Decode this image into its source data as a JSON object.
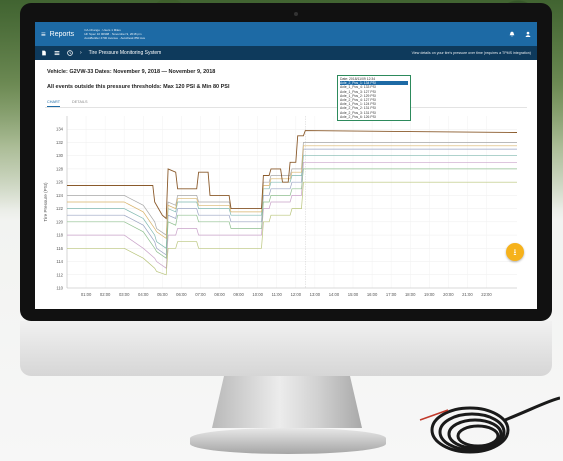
{
  "appbar": {
    "menu_icon": "≡",
    "title": "Reports",
    "info_lines": [
      "CA-Change · Users 1 Miles",
      "HF Spec 10 00998 · November 9, 2018 pm",
      "AutoBuilder 4700 Avenue · AutoDesk 850 Ave"
    ],
    "right_icons": [
      "bell-icon",
      "user-icon"
    ]
  },
  "subbar": {
    "breadcrumb": "Tire Pressure Monitoring System",
    "note": "View details on your tire's pressure over time (requires a TPMS integration)"
  },
  "page": {
    "vehicle_line": "Vehicle: G2VW-33   Dates: November 9, 2018 — November 9, 2018",
    "threshold_line": "All events outside this pressure thresholds: Max 120 PSI & Min 80 PSI"
  },
  "tabs": [
    {
      "label": "CHART",
      "active": true
    },
    {
      "label": "DETAILS",
      "active": false
    }
  ],
  "tooltip": {
    "date": "Date: 2018/11/09 12:34",
    "lines": [
      {
        "text": "Axle_2_Pos_1: 134 PSI",
        "highlight": true
      },
      {
        "text": "Axle_1_Pos_4: 133 PSI",
        "highlight": false
      },
      {
        "text": "Axle_1_Pos_3: 127 PSI",
        "highlight": false
      },
      {
        "text": "Axle_1_Pos_2: 129 PSI",
        "highlight": false
      },
      {
        "text": "Axle_2_Pos_4: 127 PSI",
        "highlight": false
      },
      {
        "text": "Axle_1_Pos_1: 124 PSI",
        "highlight": false
      },
      {
        "text": "Axle_2_Pos_2: 131 PSI",
        "highlight": false
      },
      {
        "text": "Axle_2_Pos_3: 131 PSI",
        "highlight": false
      },
      {
        "text": "Axle_2_Pos_6: 126 PSI",
        "highlight": false
      }
    ]
  },
  "fab_icon": "download-icon",
  "chart_data": {
    "type": "line",
    "ylabel": "Tire Pressure (PSI)",
    "xlabel": "",
    "ylim": [
      110,
      136
    ],
    "yticks": [
      110,
      112,
      114,
      116,
      118,
      120,
      122,
      124,
      126,
      128,
      130,
      132,
      134
    ],
    "xlim": [
      0,
      23.6
    ],
    "xticks": [
      "01:00",
      "02:00",
      "03:00",
      "04:00",
      "05:00",
      "06:00",
      "07:00",
      "08:00",
      "09:00",
      "10:00",
      "11:00",
      "12:00",
      "13:00",
      "14:00",
      "15:00",
      "16:00",
      "17:00",
      "18:00",
      "19:00",
      "20:00",
      "21:00",
      "22:00"
    ],
    "grid": true,
    "series": [
      {
        "color": "#8a5a2b",
        "x": [
          0,
          4.5,
          4.6,
          4.8,
          5.0,
          5.2,
          5.3,
          5.7,
          5.8,
          6.8,
          6.9,
          7.4,
          7.5,
          8.5,
          8.6,
          10.2,
          10.3,
          10.6,
          10.7,
          11.2,
          11.3,
          11.6,
          11.7,
          12.0,
          12.1,
          12.4,
          12.5,
          23.6
        ],
        "y": [
          125.5,
          125.5,
          123,
          122,
          121,
          120.5,
          128,
          127.5,
          125,
          125,
          127.5,
          127.5,
          124,
          124,
          122,
          122,
          127,
          127,
          128,
          128,
          126,
          126,
          129,
          129,
          133,
          133,
          133.8,
          133.5
        ]
      },
      {
        "color": "#9aa3c2",
        "x": [
          0,
          3.0,
          4.0,
          4.6,
          4.7,
          5.2,
          5.3,
          5.7,
          5.8,
          6.8,
          6.9,
          8.5,
          8.6,
          10.2,
          10.3,
          10.6,
          10.7,
          11.7,
          11.8,
          12.3,
          12.4,
          23.6
        ],
        "y": [
          121,
          121,
          119.5,
          117,
          116,
          115,
          121,
          120.5,
          122,
          122,
          121,
          121,
          120,
          120,
          124,
          124,
          125,
          125,
          126,
          126,
          131,
          131
        ]
      },
      {
        "color": "#c9a3c9",
        "x": [
          0,
          3.0,
          4.0,
          4.6,
          4.7,
          5.2,
          5.3,
          5.7,
          5.8,
          6.8,
          6.9,
          8.5,
          8.6,
          10.2,
          10.3,
          10.6,
          10.7,
          11.7,
          11.8,
          12.3,
          12.4,
          23.6
        ],
        "y": [
          118,
          118,
          116,
          114.5,
          114,
          113,
          118,
          118,
          119,
          119,
          118,
          118,
          118,
          118,
          122,
          122,
          123,
          123,
          124,
          124,
          129,
          129
        ]
      },
      {
        "color": "#7fb8b0",
        "x": [
          0,
          3.0,
          4.0,
          4.6,
          4.7,
          5.2,
          5.3,
          5.7,
          5.8,
          6.8,
          6.9,
          8.5,
          8.6,
          10.2,
          10.3,
          10.6,
          10.7,
          11.7,
          11.8,
          12.3,
          12.4,
          23.6
        ],
        "y": [
          122,
          122,
          120.5,
          118,
          117,
          116,
          122,
          121.5,
          123,
          123,
          122,
          122,
          121,
          121,
          125,
          125,
          126,
          126,
          127,
          127,
          130,
          130
        ]
      },
      {
        "color": "#b8c47a",
        "x": [
          0,
          3.0,
          4.0,
          4.6,
          4.7,
          5.2,
          5.3,
          5.7,
          5.8,
          6.8,
          6.9,
          8.5,
          8.6,
          10.2,
          10.3,
          10.6,
          10.7,
          11.7,
          11.8,
          12.3,
          12.4,
          23.6
        ],
        "y": [
          116,
          116,
          114.5,
          113,
          112.5,
          112,
          116,
          116,
          117,
          117,
          116,
          116,
          116,
          116,
          120,
          120,
          121,
          121,
          122,
          122,
          126,
          126
        ]
      },
      {
        "color": "#8fbf8f",
        "x": [
          0,
          3.0,
          4.0,
          4.6,
          4.7,
          5.2,
          5.3,
          5.7,
          5.8,
          6.8,
          6.9,
          8.5,
          8.6,
          10.2,
          10.3,
          10.6,
          10.7,
          11.7,
          11.8,
          12.3,
          12.4,
          23.6
        ],
        "y": [
          120,
          120,
          118.5,
          116,
          115.5,
          114.5,
          120,
          119.5,
          121,
          121,
          120,
          120,
          119,
          119,
          123,
          123,
          124,
          124,
          125,
          125,
          128,
          128
        ]
      },
      {
        "color": "#a8a8a8",
        "x": [
          0,
          3.0,
          4.0,
          4.6,
          4.7,
          5.2,
          5.3,
          5.7,
          5.8,
          6.8,
          6.9,
          8.5,
          8.6,
          10.2,
          10.3,
          10.6,
          10.7,
          11.7,
          11.8,
          12.3,
          12.4,
          23.6
        ],
        "y": [
          124,
          124,
          122.5,
          120,
          119,
          118,
          123,
          122.5,
          124,
          124,
          123,
          123,
          122,
          122,
          126,
          126,
          127,
          127,
          128,
          128,
          132,
          132
        ]
      },
      {
        "color": "#d8b36a",
        "x": [
          0,
          3.0,
          4.0,
          4.6,
          4.7,
          5.2,
          5.3,
          5.7,
          5.8,
          6.8,
          6.9,
          8.5,
          8.6,
          10.2,
          10.3,
          10.6,
          10.7,
          11.7,
          11.8,
          12.3,
          12.4,
          23.6
        ],
        "y": [
          123,
          123,
          121.5,
          119,
          118.5,
          117.5,
          122.5,
          122,
          123.5,
          123.5,
          122.5,
          122.5,
          121.5,
          121.5,
          125.5,
          125.5,
          126.5,
          126.5,
          127.5,
          127.5,
          131.5,
          131.5
        ]
      }
    ]
  }
}
